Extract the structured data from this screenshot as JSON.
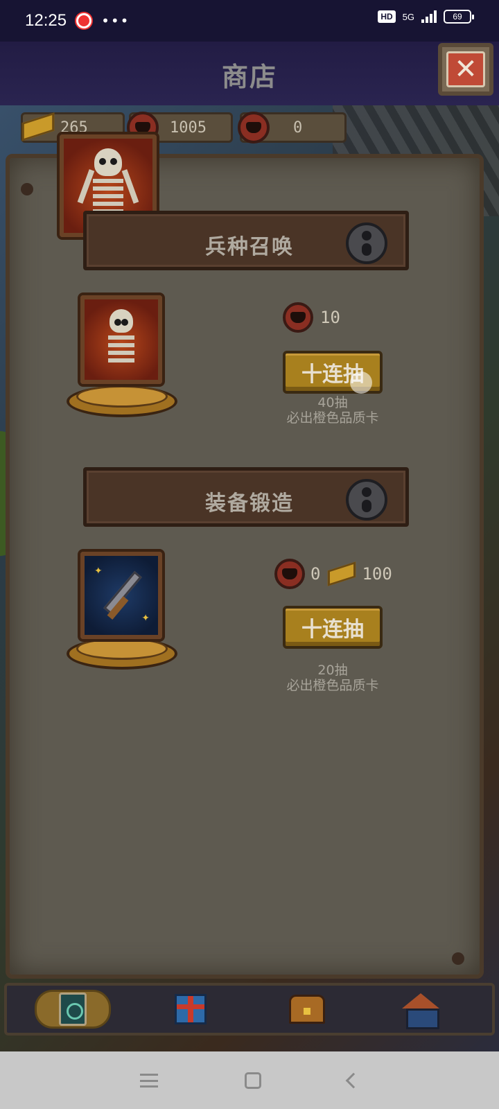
{
  "status_bar": {
    "time": "12:25",
    "dots": "•••",
    "hd": "HD",
    "network": "5G",
    "battery": "69"
  },
  "header": {
    "title": "商店",
    "close_glyph": "✕"
  },
  "currencies": [
    {
      "icon": "gold-bar-icon",
      "value": "265"
    },
    {
      "icon": "skull-coin-icon",
      "value": "1005"
    },
    {
      "icon": "anvil-coin-icon",
      "value": "0"
    }
  ],
  "sections": [
    {
      "title": "兵种召唤",
      "cost": {
        "icon": "skull-coin-icon",
        "amount": "10"
      },
      "button_label": "十连抽",
      "note_line1": "40抽",
      "note_line2": "必出橙色品质卡"
    },
    {
      "title": "装备锻造",
      "cost": {
        "icon": "anvil-coin-icon",
        "amount": "0",
        "gold_amount": "100"
      },
      "button_label": "十连抽",
      "note_line1": "20抽",
      "note_line2": "必出橙色品质卡"
    }
  ],
  "tabs": [
    {
      "name": "cards",
      "icon": "card-icon",
      "active": true
    },
    {
      "name": "gifts",
      "icon": "gift-icon",
      "active": false
    },
    {
      "name": "chest",
      "icon": "chest-icon",
      "active": false
    },
    {
      "name": "base",
      "icon": "hut-icon",
      "active": false
    }
  ],
  "colors": {
    "accent_gold": "#a8801e",
    "close_red": "#c04a36",
    "header_bg": "#221c44"
  }
}
